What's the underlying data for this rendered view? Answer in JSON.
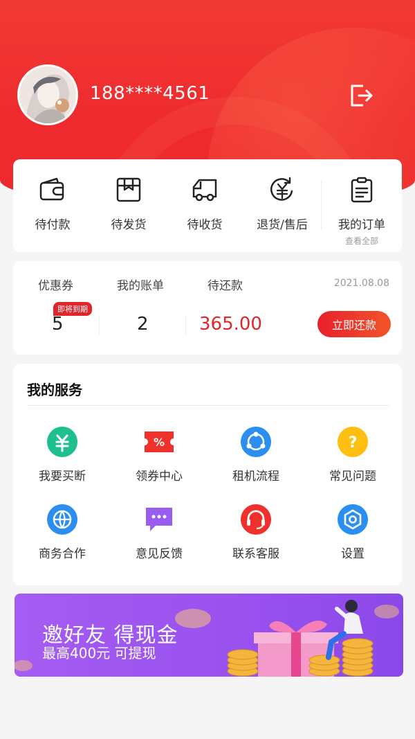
{
  "profile": {
    "phone": "188****4561"
  },
  "orders": {
    "items": [
      {
        "label": "待付款",
        "icon": "wallet-icon"
      },
      {
        "label": "待发货",
        "icon": "box-icon"
      },
      {
        "label": "待收货",
        "icon": "truck-icon"
      },
      {
        "label": "退货/售后",
        "icon": "refund-icon"
      },
      {
        "label": "我的订单",
        "sub": "查看全部",
        "icon": "clipboard-icon"
      }
    ]
  },
  "bills": {
    "coupon_label": "优惠券",
    "bill_label": "我的账单",
    "due_label": "待还款",
    "date": "2021.08.08",
    "coupon_badge": "即将到期",
    "coupon_count": "5",
    "bill_count": "2",
    "due_amount": "365.00",
    "repay_button": "立即还款"
  },
  "services": {
    "title": "我的服务",
    "items": [
      {
        "label": "我要买断",
        "icon": "yuan-icon",
        "color": "#1fbf8e"
      },
      {
        "label": "领券中心",
        "icon": "coupon-icon",
        "color": "#f0312b"
      },
      {
        "label": "租机流程",
        "icon": "flow-icon",
        "color": "#2c8ff0"
      },
      {
        "label": "常见问题",
        "icon": "question-icon",
        "color": "#ffbf12"
      },
      {
        "label": "商务合作",
        "icon": "globe-icon",
        "color": "#2c8ff0"
      },
      {
        "label": "意见反馈",
        "icon": "chat-icon",
        "color": "#9b5cf0"
      },
      {
        "label": "联系客服",
        "icon": "headset-icon",
        "color": "#f0312b"
      },
      {
        "label": "设置",
        "icon": "settings-icon",
        "color": "#2c8ff0"
      }
    ]
  },
  "banner": {
    "title": "邀好友 得现金",
    "subtitle": "最高400元 可提现"
  },
  "colors": {
    "brand_red": "#ec2a2d",
    "accent_red": "#e0262b",
    "banner_purple": "#9a52ef"
  }
}
